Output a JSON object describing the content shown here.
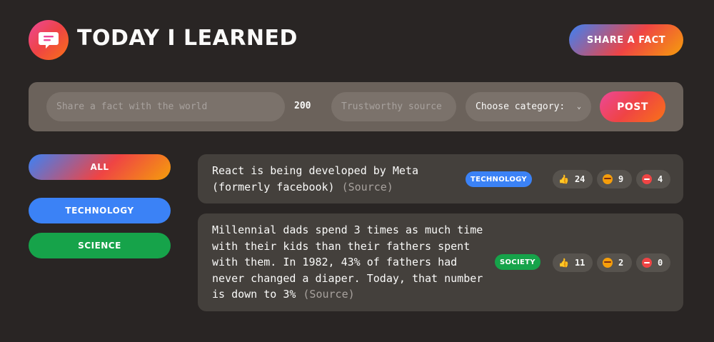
{
  "header": {
    "title": "Today I Learned",
    "share_button": "Share a fact",
    "logo_icon": "speech-bubble-icon"
  },
  "form": {
    "fact_placeholder": "Share a fact with the world",
    "char_count": "200",
    "source_placeholder": "Trustworthy source",
    "category_select": "Choose category:",
    "post_button": "Post"
  },
  "categories": [
    {
      "label": "All",
      "color": "#3b82f6"
    },
    {
      "label": "Technology",
      "color": "#3b82f6"
    },
    {
      "label": "Science",
      "color": "#16a34a"
    }
  ],
  "facts": [
    {
      "text": "React is being developed by Meta (formerly facebook)",
      "source": "(Source)",
      "tag": "Technology",
      "tag_color": "#3b82f6",
      "votes": {
        "interesting": "24",
        "mindblowing": "9",
        "false": "4"
      }
    },
    {
      "text": "Millennial dads spend 3 times as much time with their kids than their fathers spent with them. In 1982, 43% of fathers had never changed a diaper. Today, that number is down to 3%",
      "source": "(Source)",
      "tag": "Society",
      "tag_color": "#16a34a",
      "votes": {
        "interesting": "11",
        "mindblowing": "2",
        "false": "0"
      }
    }
  ],
  "colors": {
    "background": "#292524",
    "form_bg": "#6b625b",
    "card_bg": "#44403c",
    "accent_gradient": [
      "#3b82f6",
      "#ef4444",
      "#f59e0b"
    ]
  }
}
